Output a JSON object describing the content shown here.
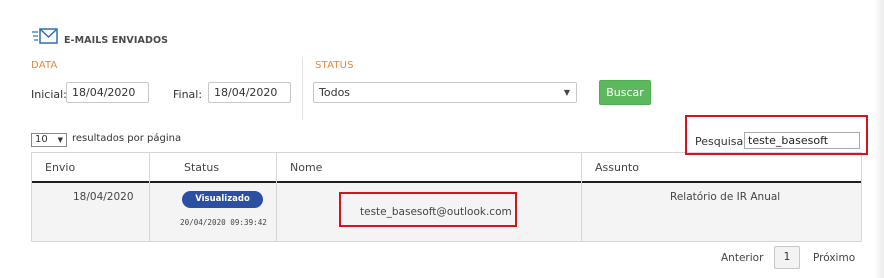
{
  "header": {
    "title": "E-MAILS ENVIADOS",
    "icon": "mail-sent-icon"
  },
  "filters": {
    "data_label": "DATA",
    "inicial_label": "Inicial:",
    "inicial_value": "18/04/2020",
    "final_label": "Final:",
    "final_value": "18/04/2020",
    "status_label": "STATUS",
    "status_value": "Todos",
    "search_button": "Buscar"
  },
  "table_controls": {
    "page_size": "10",
    "page_size_label": "resultados por página",
    "search_label": "Pesquisar",
    "search_value": "teste_basesoft"
  },
  "table": {
    "columns": [
      "Envio",
      "Status",
      "Nome",
      "Assunto"
    ],
    "rows": [
      {
        "envio": "18/04/2020",
        "status": "Visualizado",
        "status_time": "20/04/2020 09:39:42",
        "nome": "teste_basesoft@outlook.com",
        "assunto": "Relatório de IR Anual"
      }
    ]
  },
  "pagination": {
    "prev": "Anterior",
    "page": "1",
    "next": "Próximo"
  },
  "colors": {
    "accent_orange": "#e8853a",
    "button_green": "#5cb85c",
    "badge_blue": "#2c4ea3",
    "highlight_red": "#d4141b"
  }
}
